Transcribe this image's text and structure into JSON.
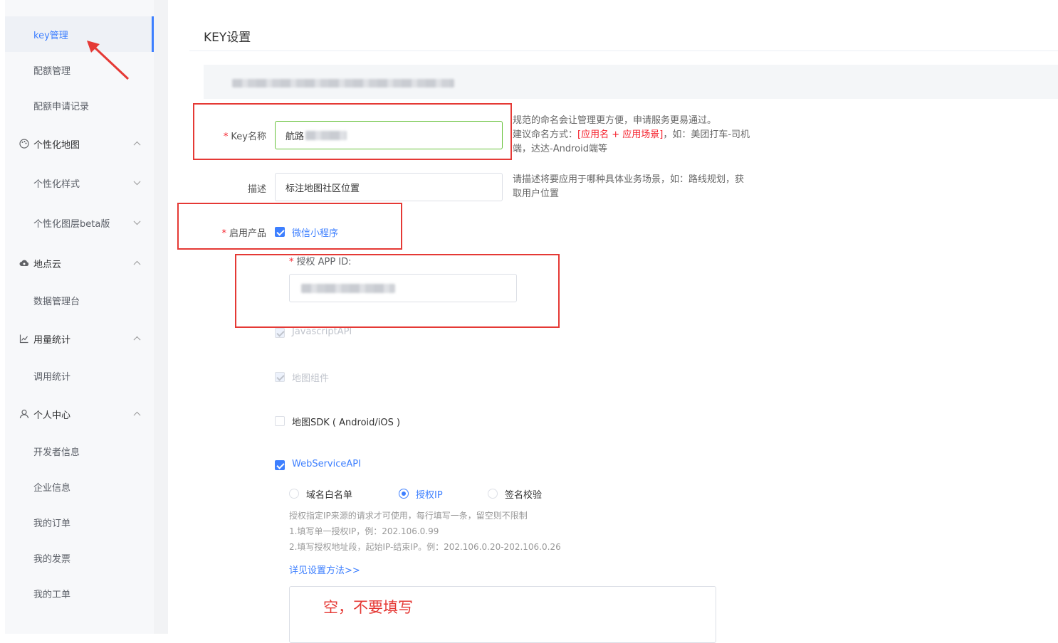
{
  "sidebar": {
    "items": [
      {
        "label": "key管理",
        "active": true
      },
      {
        "label": "配额管理"
      },
      {
        "label": "配额申请记录"
      }
    ],
    "groups": [
      {
        "label": "个性化地图",
        "icon": "palette-icon"
      },
      {
        "label": "地点云",
        "icon": "cloud-icon"
      },
      {
        "label": "用量统计",
        "icon": "chart-icon"
      },
      {
        "label": "个人中心",
        "icon": "user-icon"
      }
    ],
    "sub": {
      "style": "个性化样式",
      "layer": "个性化图层beta版",
      "data_console": "数据管理台",
      "call_stats": "调用统计",
      "dev_info": "开发者信息",
      "company_info": "企业信息",
      "orders": "我的订单",
      "invoices": "我的发票",
      "tickets": "我的工单"
    }
  },
  "main": {
    "title": "KEY设置",
    "form": {
      "key_name_label": "Key名称",
      "key_name_value": "航路",
      "key_hint_1": "规范的命名会让管理更方便，申请服务更易通过。",
      "key_hint_2a": "建议命名方式：",
      "key_hint_2b": "[应用名 + 应用场景]",
      "key_hint_2c": "，如：美团打车-司机",
      "key_hint_3": "端，达达-Android端等",
      "desc_label": "描述",
      "desc_value": "标注地图社区位置",
      "desc_hint_1": "请描述将要应用于哪种具体业务场景，如：路线规划，获",
      "desc_hint_2": "取用户位置",
      "product_label": "启用产品",
      "products": {
        "miniprogram": "微信小程序",
        "appid_label": "授权 APP ID:",
        "jsapi": "JavascriptAPI",
        "component": "地图组件",
        "sdk": "地图SDK ( Android/iOS )",
        "webservice": "WebServiceAPI"
      },
      "radios": {
        "domain": "域名白名单",
        "ip": "授权IP",
        "sign": "签名校验"
      },
      "ip_help_1": "授权指定IP来源的请求才可使用，每行填写一条，留空则不限制",
      "ip_help_2": "1.填写单一授权IP，例：202.106.0.99",
      "ip_help_3": "2.填写授权地址段，起始IP-结束IP。例：202.106.0.20-202.106.0.26",
      "settings_link": "详见设置方法>>",
      "annotation": "空，不要填写"
    }
  },
  "colors": {
    "accent": "#3d7fff",
    "annotation": "#e53935",
    "required": "#f5222d"
  }
}
